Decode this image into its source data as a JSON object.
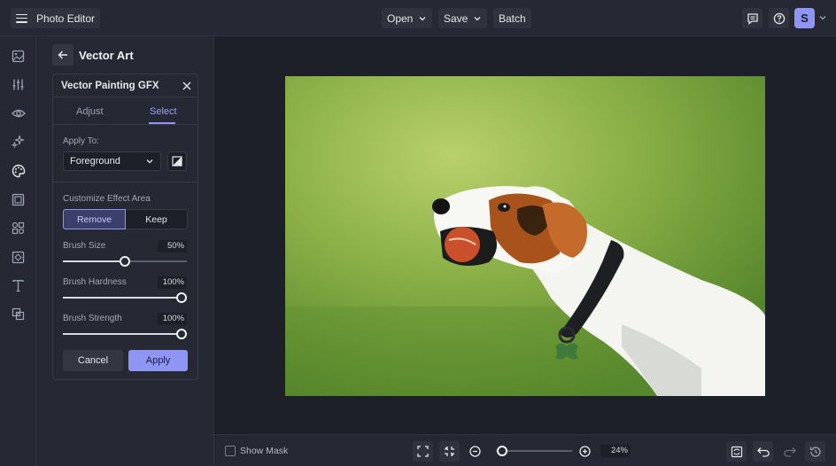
{
  "header": {
    "app_title": "Photo Editor",
    "menu": [
      {
        "label": "Open"
      },
      {
        "label": "Save"
      },
      {
        "label": "Batch"
      }
    ],
    "avatar_initial": "S"
  },
  "rail": {
    "icons": [
      "image-icon",
      "sliders-icon",
      "eye-icon",
      "sparkle-icon",
      "palette-icon",
      "frame-icon",
      "shapes-icon",
      "texture-icon",
      "text-icon",
      "layers-icon"
    ]
  },
  "panel": {
    "title": "Vector Art",
    "card_title": "Vector Painting GFX",
    "tabs": [
      "Adjust",
      "Select"
    ],
    "active_tab": "Select",
    "apply_to_label": "Apply To:",
    "apply_to_value": "Foreground",
    "customize_label": "Customize Effect Area",
    "mode_remove": "Remove",
    "mode_keep": "Keep",
    "active_mode": "Remove",
    "sliders": [
      {
        "label": "Brush Size",
        "value": 50,
        "display": "50%"
      },
      {
        "label": "Brush Hardness",
        "value": 100,
        "display": "100%"
      },
      {
        "label": "Brush Strength",
        "value": 100,
        "display": "100%"
      }
    ],
    "cancel_label": "Cancel",
    "apply_label": "Apply"
  },
  "bottombar": {
    "show_mask_label": "Show Mask",
    "show_mask_checked": false,
    "zoom_display": "24%",
    "zoom_value": 24
  },
  "colors": {
    "accent": "#8f95f2",
    "bg": "#1e2029",
    "panel": "#262833"
  }
}
